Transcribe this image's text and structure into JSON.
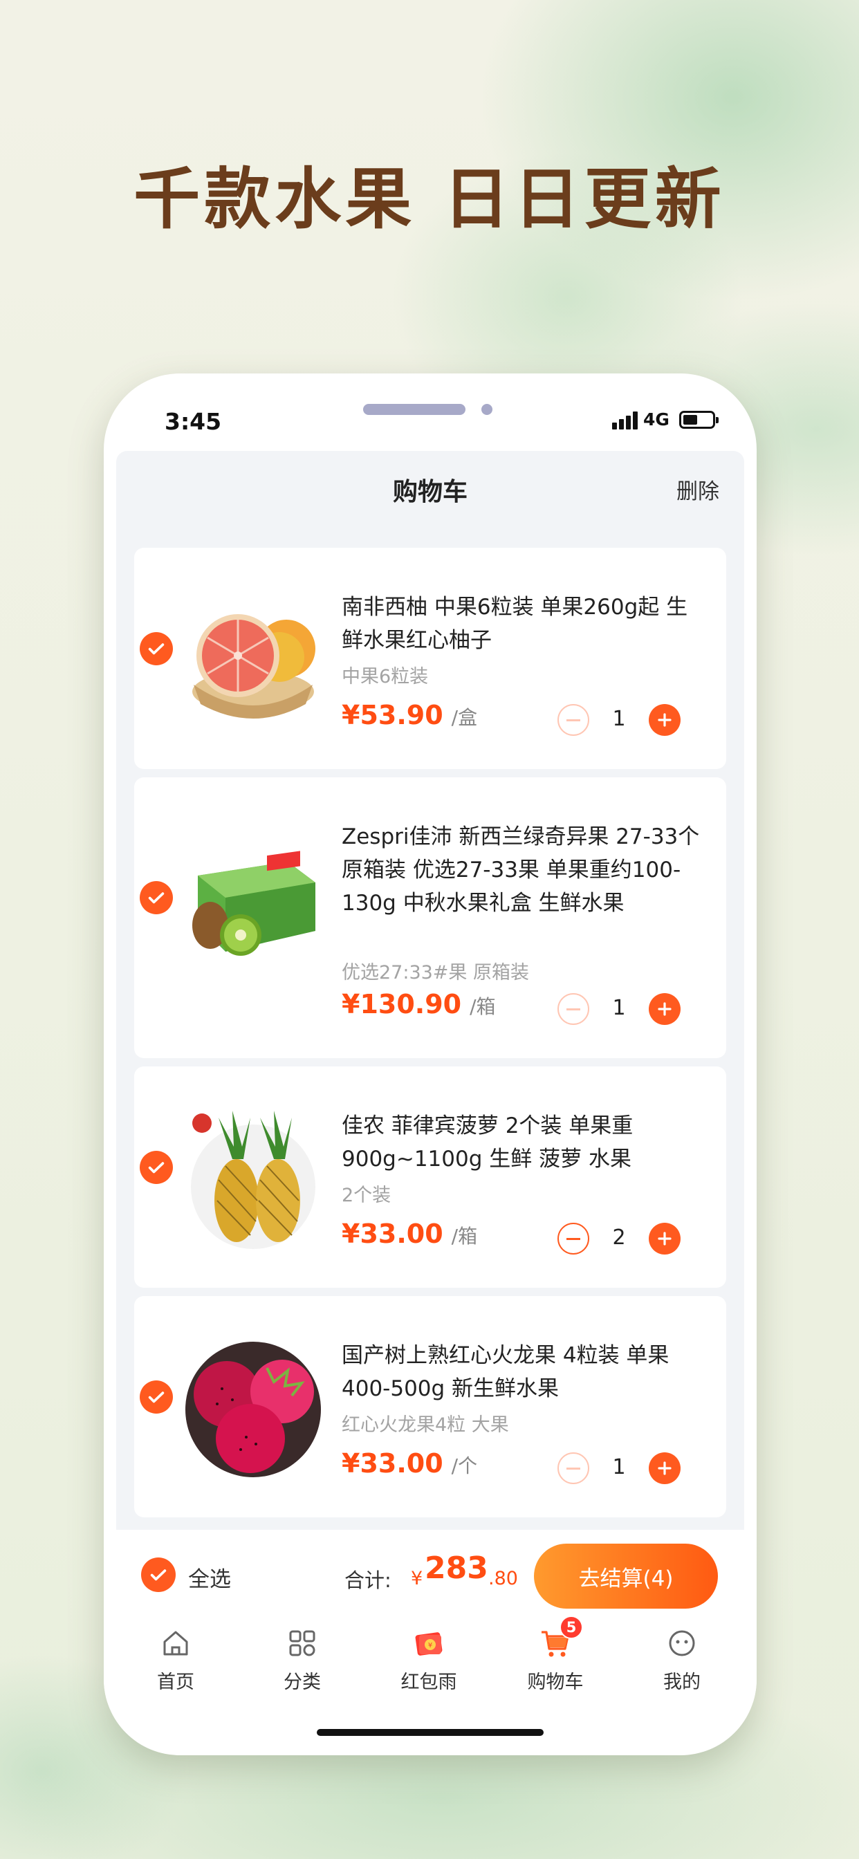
{
  "headline": "千款水果 日日更新",
  "status": {
    "time": "3:45",
    "network": "4G"
  },
  "nav": {
    "title": "购物车",
    "delete_label": "删除"
  },
  "items": [
    {
      "title": "南非西柚 中果6粒装 单果260g起 生鲜水果红心柚子",
      "spec": "中果6粒装",
      "price": "¥53.90",
      "unit": "/盒",
      "qty": "1"
    },
    {
      "title": "Zespri佳沛 新西兰绿奇异果 27-33个原箱装 优选27-33果 单果重约100-130g 中秋水果礼盒 生鲜水果",
      "spec": "优选27:33#果 原箱装",
      "price": "¥130.90",
      "unit": "/箱",
      "qty": "1"
    },
    {
      "title": "佳农 菲律宾菠萝 2个装 单果重900g~1100g 生鲜 菠萝 水果",
      "spec": "2个装",
      "price": "¥33.00",
      "unit": "/箱",
      "qty": "2"
    },
    {
      "title": "国产树上熟红心火龙果 4粒装 单果400-500g 新生鲜水果",
      "spec": "红心火龙果4粒 大果",
      "price": "¥33.00",
      "unit": "/个",
      "qty": "1"
    }
  ],
  "checkout": {
    "select_all_label": "全选",
    "total_label": "合计:",
    "total_yen": "¥",
    "total_int": "283",
    "total_dec": ".80",
    "button_label": "去结算(4)"
  },
  "tabs": [
    {
      "label": "首页",
      "icon": "home-icon"
    },
    {
      "label": "分类",
      "icon": "category-icon"
    },
    {
      "label": "红包雨",
      "icon": "red-envelope-icon"
    },
    {
      "label": "购物车",
      "icon": "cart-icon",
      "badge": "5"
    },
    {
      "label": "我的",
      "icon": "profile-icon"
    }
  ],
  "colors": {
    "accent": "#ff5a1f",
    "price": "#ff4d12",
    "headline": "#6b3d1c"
  }
}
